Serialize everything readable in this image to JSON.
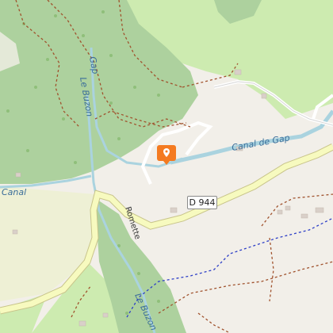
{
  "map": {
    "labels": {
      "gap_upper": "Gap",
      "le_buzon": "Le Buzon",
      "canal_de_gap": "Canal de Gap",
      "canal_left": "Canal",
      "road": "D 944",
      "romette": "Romette",
      "le_buzon_lower": "Le Buzon"
    },
    "marker": {
      "icon": "location-pin-icon",
      "color": "#f47a20"
    },
    "colors": {
      "land": "#f2efe9",
      "forest": "#add19e",
      "meadow": "#cdebb0",
      "water": "#aad3df",
      "road": "#f7fabf",
      "road_casing": "#c8c48a",
      "path": "#a0522d",
      "boundary": "#2e3fc7"
    }
  }
}
